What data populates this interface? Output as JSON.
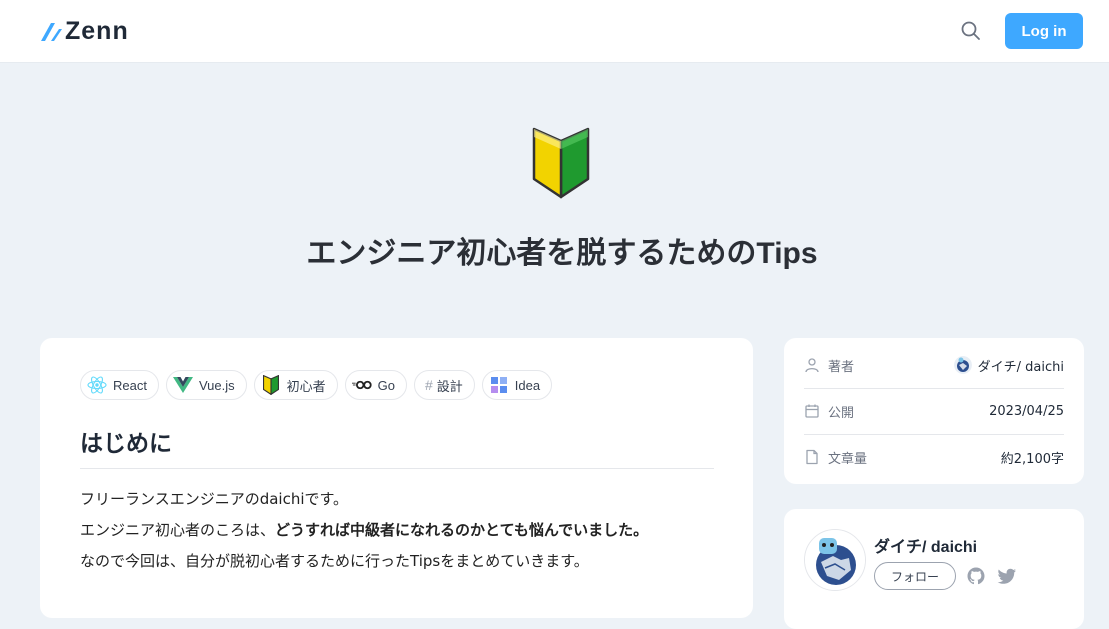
{
  "header": {
    "logo_text": "Zenn",
    "login_label": "Log in",
    "brand_color": "#3ea8ff"
  },
  "article": {
    "emoji": "beginner-mark-icon",
    "title": "エンジニア初心者を脱するためのTips",
    "topics": [
      {
        "label": "React",
        "icon": "react-icon"
      },
      {
        "label": "Vue.js",
        "icon": "vue-icon"
      },
      {
        "label": "初心者",
        "icon": "beginner-mark-icon"
      },
      {
        "label": "Go",
        "icon": "go-icon"
      },
      {
        "label": "設計",
        "icon": "hash-icon"
      },
      {
        "label": "Idea",
        "icon": "idea-icon"
      }
    ],
    "section_heading": "はじめに",
    "paragraphs": {
      "line1": "フリーランスエンジニアのdaichiです。",
      "line2_prefix": "エンジニア初心者のころは、",
      "line2_bold": "どうすれば中級者になれるのかとても悩んでいました。",
      "line3": "なので今回は、自分が脱初心者するために行ったTipsをまとめていきます。"
    }
  },
  "meta": {
    "author_label": "著者",
    "author_value": "ダイチ/ daichi",
    "published_label": "公開",
    "published_value": "2023/04/25",
    "length_label": "文章量",
    "length_value": "約2,100字"
  },
  "author_card": {
    "name": "ダイチ/ daichi",
    "follow_label": "フォロー",
    "socials": [
      "github-icon",
      "twitter-icon"
    ]
  }
}
